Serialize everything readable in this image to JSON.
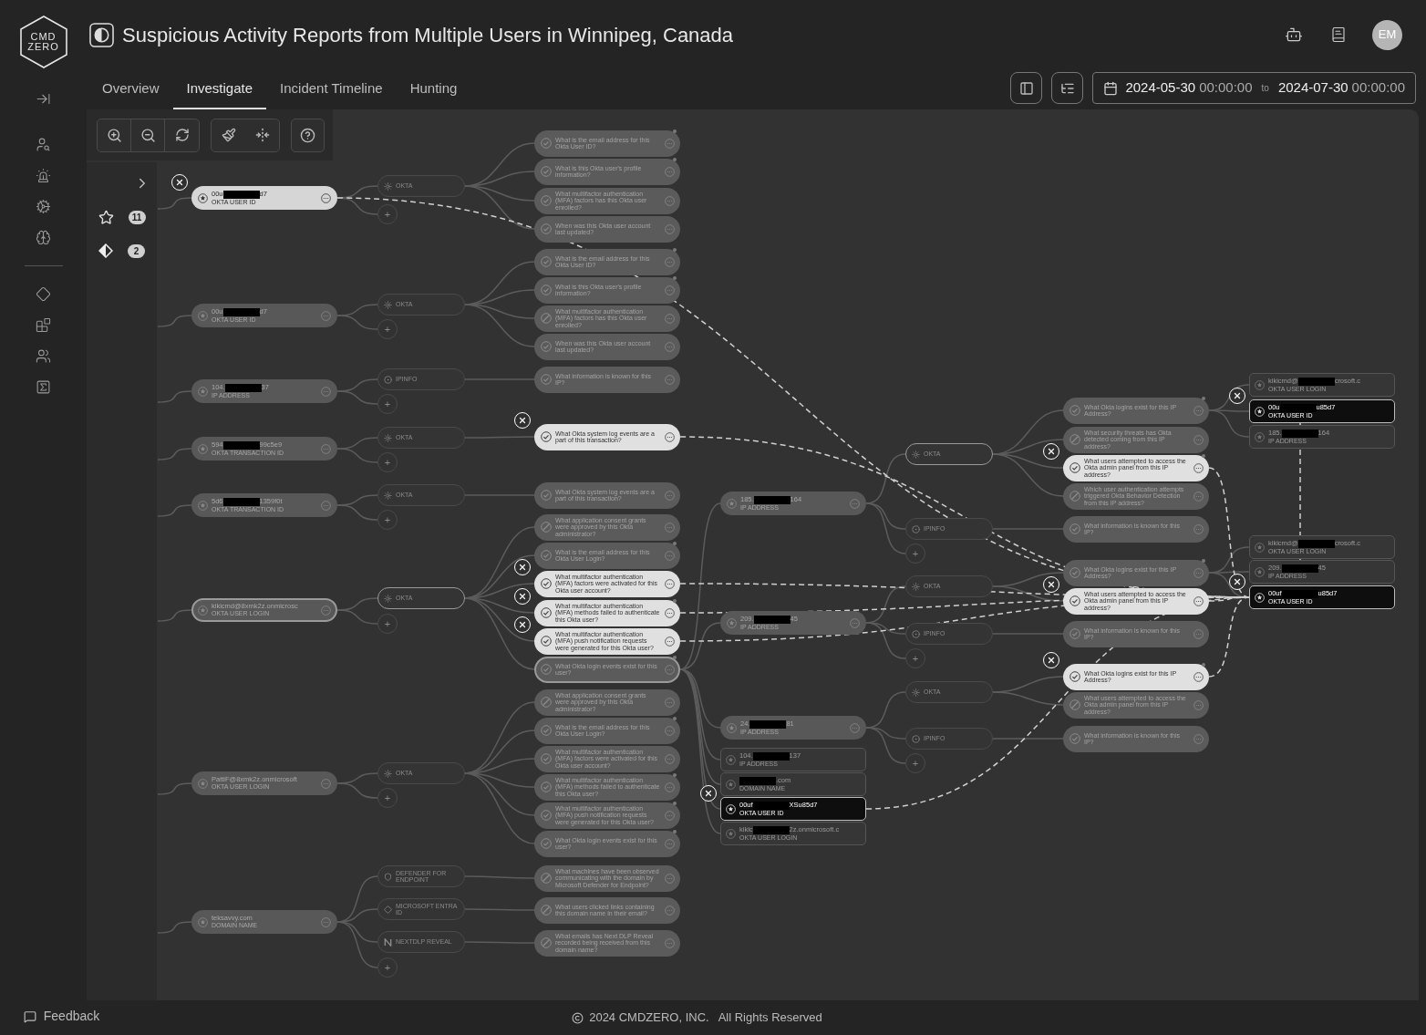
{
  "logo": {
    "lines": [
      "CMD",
      "ZERO"
    ]
  },
  "title": "Suspicious Activity Reports from Multiple Users in Winnipeg, Canada",
  "tabs": [
    {
      "label": "Overview",
      "selected": false
    },
    {
      "label": "Investigate",
      "selected": true
    },
    {
      "label": "Incident Timeline",
      "selected": false
    },
    {
      "label": "Hunting",
      "selected": false
    }
  ],
  "date_range": {
    "start_date": "2024-05-30",
    "start_time": "00:00:00",
    "separator": "to",
    "end_date": "2024-07-30",
    "end_time": "00:00:00"
  },
  "user": {
    "initials": "EM"
  },
  "side_panel": {
    "badges": [
      {
        "count": "11"
      },
      {
        "count": "2"
      }
    ]
  },
  "graph": {
    "nodes": [
      {
        "kind": "entity",
        "value": "00u",
        "redacted": true,
        "value_end": "d7",
        "type": "OKTA USER ID",
        "selected": true,
        "on_path": false
      },
      {
        "kind": "entity",
        "value": "00u",
        "redacted": true,
        "value_end": "d7",
        "type": "OKTA USER ID",
        "selected": false,
        "on_path": false
      },
      {
        "kind": "entity",
        "value": "104.",
        "redacted": true,
        "value_end": "37",
        "type": "IP ADDRESS",
        "selected": false,
        "on_path": false
      },
      {
        "kind": "entity",
        "value": "594",
        "redacted": true,
        "value_end": "99c5e9",
        "type": "OKTA TRANSACTION ID",
        "selected": false,
        "on_path": false
      },
      {
        "kind": "entity",
        "value": "5d6",
        "redacted": true,
        "value_end": "1359f0t",
        "type": "OKTA TRANSACTION ID",
        "selected": false,
        "on_path": false
      },
      {
        "kind": "entity",
        "value": "kikicmd@8xmk2z.onmicrosc",
        "redacted": false,
        "type": "OKTA USER LOGIN",
        "selected": false,
        "on_path": true
      },
      {
        "kind": "entity",
        "value": "PattiF@8xmk2z.onmicrosoft",
        "redacted": false,
        "type": "OKTA USER LOGIN",
        "selected": false,
        "on_path": false
      },
      {
        "kind": "entity",
        "value": "teksavvy.com",
        "redacted": false,
        "type": "DOMAIN NAME",
        "selected": false,
        "on_path": false
      },
      {
        "kind": "integration",
        "label": "OKTA",
        "selected": false,
        "on_path": false
      },
      {
        "kind": "add",
        "label": "+",
        "selected": false,
        "on_path": false
      },
      {
        "kind": "integration",
        "label": "OKTA",
        "selected": false,
        "on_path": false
      },
      {
        "kind": "add",
        "label": "+",
        "selected": false,
        "on_path": false
      },
      {
        "kind": "integration",
        "label": "IPINFO",
        "selected": false,
        "on_path": false
      },
      {
        "kind": "add",
        "label": "+",
        "selected": false,
        "on_path": false
      },
      {
        "kind": "integration",
        "label": "OKTA",
        "selected": false,
        "on_path": false
      },
      {
        "kind": "add",
        "label": "+",
        "selected": false,
        "on_path": false
      },
      {
        "kind": "integration",
        "label": "OKTA",
        "selected": false,
        "on_path": false
      },
      {
        "kind": "add",
        "label": "+",
        "selected": false,
        "on_path": false
      },
      {
        "kind": "integration",
        "label": "OKTA",
        "selected": false,
        "on_path": true
      },
      {
        "kind": "add",
        "label": "+",
        "selected": false,
        "on_path": false
      },
      {
        "kind": "integration",
        "label": "OKTA",
        "selected": false,
        "on_path": false
      },
      {
        "kind": "add",
        "label": "+",
        "selected": false,
        "on_path": false
      },
      {
        "kind": "integration",
        "label": "DEFENDER FOR ENDPOINT",
        "selected": false,
        "on_path": false
      },
      {
        "kind": "integration",
        "label": "MICROSOFT ENTRA ID",
        "selected": false,
        "on_path": false
      },
      {
        "kind": "integration",
        "label": "NEXTDLP REVEAL",
        "selected": false,
        "on_path": false
      },
      {
        "kind": "add",
        "label": "+",
        "selected": false,
        "on_path": false
      },
      {
        "kind": "question",
        "text": "What is the email address for this Okta User ID?",
        "answered": true,
        "has_update": true,
        "selected": false,
        "on_path": false
      },
      {
        "kind": "question",
        "text": "What is this Okta user's profile information?",
        "answered": true,
        "has_update": true,
        "selected": false,
        "on_path": false
      },
      {
        "kind": "question",
        "text": "What multifactor authentication (MFA) factors has this Okta user enrolled?",
        "answered": true,
        "has_update": false,
        "selected": false,
        "on_path": false
      },
      {
        "kind": "question",
        "text": "When was this Okta user account last updated?",
        "answered": true,
        "has_update": false,
        "selected": false,
        "on_path": false
      },
      {
        "kind": "question",
        "text": "What is the email address for this Okta User ID?",
        "answered": true,
        "has_update": true,
        "selected": false,
        "on_path": false
      },
      {
        "kind": "question",
        "text": "What is this Okta user's profile information?",
        "answered": true,
        "has_update": true,
        "selected": false,
        "on_path": false
      },
      {
        "kind": "question",
        "text": "What multifactor authentication (MFA) factors has this Okta user enrolled?",
        "answered": false,
        "has_update": false,
        "selected": false,
        "on_path": false
      },
      {
        "kind": "question",
        "text": "When was this Okta user account last updated?",
        "answered": true,
        "has_update": false,
        "selected": false,
        "on_path": false
      },
      {
        "kind": "question",
        "text": "What information is known for this IP?",
        "answered": true,
        "has_update": false,
        "selected": false,
        "on_path": false
      },
      {
        "kind": "question",
        "text": "What Okta system log events are a part of this transaction?",
        "answered": true,
        "has_update": false,
        "selected": true,
        "on_path": false
      },
      {
        "kind": "question",
        "text": "What Okta system log events are a part of this transaction?",
        "answered": true,
        "has_update": false,
        "selected": false,
        "on_path": false
      },
      {
        "kind": "question",
        "text": "What application consent grants were approved by this Okta administrator?",
        "answered": false,
        "has_update": false,
        "selected": false,
        "on_path": false
      },
      {
        "kind": "question",
        "text": "What is the email address for this Okta User Login?",
        "answered": true,
        "has_update": true,
        "selected": false,
        "on_path": false
      },
      {
        "kind": "question",
        "text": "What multifactor authentication (MFA) factors were activated for this Okta user account?",
        "answered": true,
        "has_update": false,
        "selected": true,
        "on_path": false
      },
      {
        "kind": "question",
        "text": "What multifactor authentication (MFA) methods failed to authenticate this Okta user?",
        "answered": true,
        "has_update": true,
        "selected": true,
        "on_path": false
      },
      {
        "kind": "question",
        "text": "What multifactor authentication (MFA) push notification requests were generated for this Okta user?",
        "answered": true,
        "has_update": false,
        "selected": true,
        "on_path": false
      },
      {
        "kind": "question",
        "text": "What Okta login events exist for this user?",
        "answered": true,
        "has_update": true,
        "selected": false,
        "on_path": true
      },
      {
        "kind": "question",
        "text": "What application consent grants were approved by this Okta administrator?",
        "answered": false,
        "has_update": false,
        "selected": false,
        "on_path": false
      },
      {
        "kind": "question",
        "text": "What is the email address for this Okta User Login?",
        "answered": true,
        "has_update": true,
        "selected": false,
        "on_path": false
      },
      {
        "kind": "question",
        "text": "What multifactor authentication (MFA) factors were activated for this Okta user account?",
        "answered": true,
        "has_update": false,
        "selected": false,
        "on_path": false
      },
      {
        "kind": "question",
        "text": "What multifactor authentication (MFA) methods failed to authenticate this Okta user?",
        "answered": true,
        "has_update": true,
        "selected": false,
        "on_path": false
      },
      {
        "kind": "question",
        "text": "What multifactor authentication (MFA) push notification requests were generated for this Okta user?",
        "answered": true,
        "has_update": true,
        "selected": false,
        "on_path": false
      },
      {
        "kind": "question",
        "text": "What Okta login events exist for this user?",
        "answered": true,
        "has_update": true,
        "selected": false,
        "on_path": false
      },
      {
        "kind": "question",
        "text": "What machines have been observed communicating with the domain by Microsoft Defender for Endpoint?",
        "answered": false,
        "has_update": false,
        "selected": false,
        "on_path": false
      },
      {
        "kind": "question",
        "text": "What users clicked links containing this domain name in their email?",
        "answered": false,
        "has_update": false,
        "selected": false,
        "on_path": false
      },
      {
        "kind": "question",
        "text": "What emails has Next DLP Reveal recorded being received from this domain name?",
        "answered": false,
        "has_update": false,
        "selected": false,
        "on_path": false
      },
      {
        "kind": "entity",
        "value": "185.",
        "redacted": true,
        "value_end": "164",
        "type": "IP ADDRESS",
        "selected": false,
        "on_path": false
      },
      {
        "kind": "entity",
        "value": "209.",
        "redacted": true,
        "value_end": "45",
        "type": "IP ADDRESS",
        "selected": false,
        "on_path": false
      },
      {
        "kind": "entity",
        "value": "24.",
        "redacted": true,
        "value_end": "81",
        "type": "IP ADDRESS",
        "selected": false,
        "on_path": false
      },
      {
        "kind": "result",
        "value": "104.",
        "redacted": true,
        "value_end": "137",
        "type": "IP ADDRESS",
        "selected": false,
        "on_path": false
      },
      {
        "kind": "result",
        "redacted": true,
        "value_end": ".com",
        "type": "DOMAIN NAME",
        "selected": false,
        "on_path": false
      },
      {
        "kind": "result",
        "value": "00uf",
        "redacted": true,
        "value_end": "XSu85d7",
        "type": "OKTA USER ID",
        "selected": true,
        "on_path": false
      },
      {
        "kind": "result",
        "value": "kikic",
        "redacted": true,
        "value_end": "2z.onmicrosoft.c",
        "type": "OKTA USER LOGIN",
        "selected": false,
        "on_path": false
      },
      {
        "kind": "integration",
        "label": "OKTA",
        "selected": false,
        "on_path": true
      },
      {
        "kind": "integration",
        "label": "IPINFO",
        "selected": false,
        "on_path": false
      },
      {
        "kind": "add",
        "label": "+",
        "selected": false,
        "on_path": false
      },
      {
        "kind": "integration",
        "label": "OKTA",
        "selected": false,
        "on_path": false
      },
      {
        "kind": "integration",
        "label": "IPINFO",
        "selected": false,
        "on_path": false
      },
      {
        "kind": "add",
        "label": "+",
        "selected": false,
        "on_path": false
      },
      {
        "kind": "integration",
        "label": "OKTA",
        "selected": false,
        "on_path": false
      },
      {
        "kind": "integration",
        "label": "IPINFO",
        "selected": false,
        "on_path": false
      },
      {
        "kind": "add",
        "label": "+",
        "selected": false,
        "on_path": false
      },
      {
        "kind": "question",
        "text": "What Okta logins exist for this IP Address?",
        "answered": true,
        "has_update": true,
        "selected": false,
        "on_path": false
      },
      {
        "kind": "question",
        "text": "What security threats has Okta detected coming from this IP address?",
        "answered": false,
        "has_update": false,
        "selected": false,
        "on_path": false
      },
      {
        "kind": "question",
        "text": "What users attempted to access the Okta admin panel from this IP address?",
        "answered": true,
        "has_update": true,
        "selected": true,
        "on_path": false
      },
      {
        "kind": "question",
        "text": "Which user authentication attempts triggered Okta Behavior Detection from this IP address?",
        "answered": false,
        "has_update": false,
        "selected": false,
        "on_path": false
      },
      {
        "kind": "question",
        "text": "What information is known for this IP?",
        "answered": true,
        "has_update": false,
        "selected": false,
        "on_path": false
      },
      {
        "kind": "question",
        "text": "What Okta logins exist for this IP Address?",
        "answered": true,
        "has_update": true,
        "selected": false,
        "on_path": false
      },
      {
        "kind": "question",
        "text": "What users attempted to access the Okta admin panel from this IP address?",
        "answered": true,
        "has_update": false,
        "selected": true,
        "on_path": false
      },
      {
        "kind": "question",
        "text": "What information is known for this IP?",
        "answered": true,
        "has_update": false,
        "selected": false,
        "on_path": false
      },
      {
        "kind": "question",
        "text": "What Okta logins exist for this IP Address?",
        "answered": true,
        "has_update": true,
        "selected": true,
        "on_path": false
      },
      {
        "kind": "question",
        "text": "What users attempted to access the Okta admin panel from this IP address?",
        "answered": false,
        "has_update": false,
        "selected": false,
        "on_path": false
      },
      {
        "kind": "question",
        "text": "What information is known for this IP?",
        "answered": true,
        "has_update": false,
        "selected": false,
        "on_path": false
      },
      {
        "kind": "result",
        "value": "kikicmd@",
        "redacted": true,
        "value_end": "crosoft.c",
        "type": "OKTA USER LOGIN",
        "selected": false,
        "on_path": false
      },
      {
        "kind": "result",
        "value": "00u",
        "redacted": true,
        "value_end": "u85d7",
        "type": "OKTA USER ID",
        "selected": true,
        "on_path": false
      },
      {
        "kind": "result",
        "value": "185.",
        "redacted": true,
        "value_end": "164",
        "type": "IP ADDRESS",
        "selected": false,
        "on_path": false
      },
      {
        "kind": "result",
        "value": "kikicmd@",
        "redacted": true,
        "value_end": "crosoft.c",
        "type": "OKTA USER LOGIN",
        "selected": false,
        "on_path": false
      },
      {
        "kind": "result",
        "value": "209.",
        "redacted": true,
        "value_end": "45",
        "type": "IP ADDRESS",
        "selected": false,
        "on_path": false
      },
      {
        "kind": "result",
        "value": "00uf",
        "redacted": true,
        "value_end": "u85d7",
        "type": "OKTA USER ID",
        "selected": true,
        "on_path": false
      }
    ]
  },
  "feedback": "Feedback",
  "footer": {
    "company": "2024 CMDZERO, INC.",
    "rights": "All Rights Reserved"
  }
}
